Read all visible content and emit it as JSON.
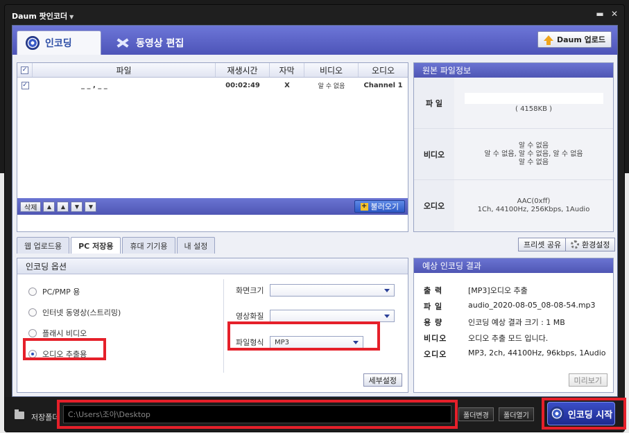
{
  "window": {
    "title": "Daum 팟인코더"
  },
  "main_tabs": [
    {
      "label": "인코딩"
    },
    {
      "label": "동영상 편집"
    }
  ],
  "daum_upload": "Daum 업로드",
  "file_table": {
    "columns": [
      "파일",
      "재생시간",
      "자막",
      "비디오",
      "오디오"
    ],
    "rows": [
      {
        "file": "_          _            , _ _",
        "duration": "00:02:49",
        "subtitle": "X",
        "video": "알 수 없음",
        "audio": "Channel 1"
      }
    ],
    "toolbar": {
      "delete": "삭제",
      "load": "불러오기"
    }
  },
  "source_info": {
    "title": "원본 파일정보",
    "rows": [
      {
        "label": "파 일",
        "lines": [
          "( 4158KB )"
        ]
      },
      {
        "label": "비디오",
        "lines": [
          "알 수 없음",
          "알 수 없음, 알 수 없음, 알 수 없음",
          "알 수 없음"
        ]
      },
      {
        "label": "오디오",
        "lines": [
          "AAC(0xff)",
          "1Ch, 44100Hz, 256Kbps, 1Audio"
        ]
      }
    ]
  },
  "sub_tabs": [
    "웹 업로드용",
    "PC 저장용",
    "휴대 기기용",
    "내 설정"
  ],
  "preset_share": "프리셋 공유",
  "env_settings": "환경설정",
  "encoding_options": {
    "title": "인코딩 옵션",
    "radios": [
      {
        "label": "PC/PMP 용",
        "selected": false
      },
      {
        "label": "인터넷 동영상(스트리밍)",
        "selected": false
      },
      {
        "label": "플래시 비디오",
        "selected": false
      },
      {
        "label": "오디오 추출용",
        "selected": true
      }
    ],
    "fields": [
      {
        "label": "화면크기",
        "value": ""
      },
      {
        "label": "영상화질",
        "value": ""
      },
      {
        "label": "파일형식",
        "value": "MP3"
      }
    ],
    "detail_button": "세부설정"
  },
  "expected_result": {
    "title": "예상 인코딩 결과",
    "rows": [
      {
        "label": "출 력",
        "value": "[MP3]오디오 추출"
      },
      {
        "label": "파 일",
        "value": "audio_2020-08-05_08-08-54.mp3"
      },
      {
        "label": "용 량",
        "value": "인코딩 예상 결과 크기 : 1 MB"
      },
      {
        "label": "비디오",
        "value": "오디오 추출 모드 입니다."
      },
      {
        "label": "오디오",
        "value": "MP3, 2ch, 44100Hz, 96kbps, 1Audio"
      }
    ],
    "preview_button": "미리보기"
  },
  "save_folder": {
    "label": "저장폴더",
    "path": "C:\\Users\\조아\\Desktop",
    "change_button": "폴더변경",
    "open_button": "폴더열기"
  },
  "start_button": "인코딩 시작",
  "colors": {
    "highlight": "#e5202a",
    "tab_blue": "#5058c0",
    "start_blue": "#2a3cb0"
  }
}
